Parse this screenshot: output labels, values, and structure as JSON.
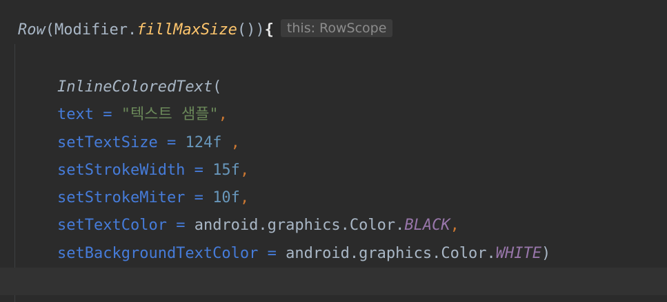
{
  "editor": {
    "line1": {
      "fn": "Row",
      "open_paren": "(",
      "receiver": "Modifier.",
      "ext_fn": "fillMaxSize",
      "call_close": "())",
      "brace": "{",
      "hint": "this: RowScope"
    },
    "line2": {
      "fn": "InlineColoredText",
      "open_paren": "("
    },
    "line3": {
      "param": "text",
      "eq": " = ",
      "value": "\"텍스트 샘플\"",
      "comma": ","
    },
    "line4": {
      "param": "setTextSize",
      "eq": " = ",
      "value": "124f",
      "comma": " ,"
    },
    "line5": {
      "param": "setStrokeWidth",
      "eq": " = ",
      "value": "15f",
      "comma": ","
    },
    "line6": {
      "param": "setStrokeMiter",
      "eq": " = ",
      "value": "10f",
      "comma": ","
    },
    "line7": {
      "param": "setTextColor",
      "eq": " = ",
      "qualifier": "android.graphics.Color.",
      "const": "BLACK",
      "comma": ","
    },
    "line8": {
      "param": "setBackgroundTextColor",
      "eq": " = ",
      "qualifier": "android.graphics.Color.",
      "const": "WHITE",
      "close_paren": ")"
    }
  }
}
